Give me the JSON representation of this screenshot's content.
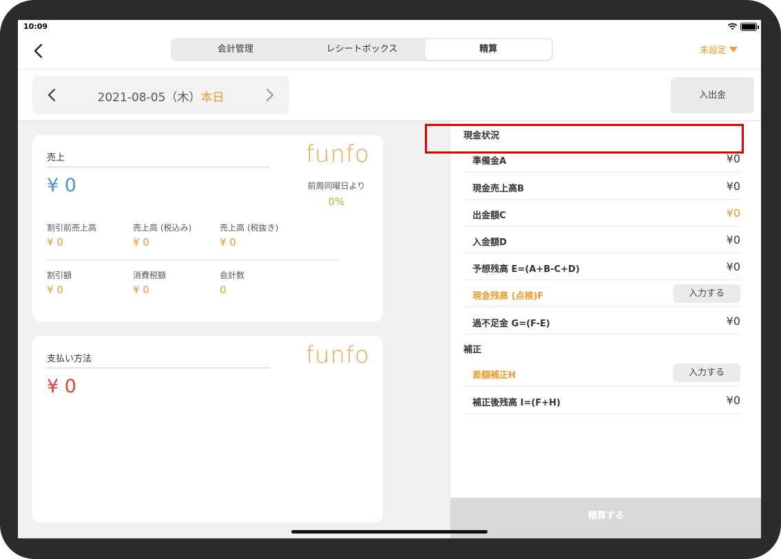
{
  "status": {
    "time": "10:09"
  },
  "nav": {
    "tabs": [
      {
        "label": "会計管理",
        "active": false
      },
      {
        "label": "レシートボックス",
        "active": false
      },
      {
        "label": "精算",
        "active": true
      }
    ],
    "status_label": "未設定"
  },
  "datebar": {
    "date": "2021-08-05（木）",
    "today": "本日",
    "inout_label": "入出金"
  },
  "sales_card": {
    "title": "売上",
    "total": "¥ 0",
    "logo": "funfo",
    "compare_label": "前周同曜日より",
    "compare_value": "0%",
    "metrics": [
      {
        "label": "割引前売上高",
        "value": "¥ 0"
      },
      {
        "label": "売上高 (税込み)",
        "value": "¥ 0"
      },
      {
        "label": "売上高 (税抜き)",
        "value": "¥ 0"
      },
      {
        "label": "割引額",
        "value": "¥ 0"
      },
      {
        "label": "消費税額",
        "value": "¥ 0"
      },
      {
        "label": "会計数",
        "value": "0"
      }
    ]
  },
  "payment_card": {
    "title": "支払い方法",
    "total": "¥ 0",
    "logo": "funfo"
  },
  "cash_status": {
    "title": "現金状況",
    "rows": [
      {
        "label": "準備金A",
        "value": "¥0"
      },
      {
        "label": "現金売上高B",
        "value": "¥0"
      },
      {
        "label": "出金額C",
        "value": "¥0"
      },
      {
        "label": "入金額D",
        "value": "¥0"
      },
      {
        "label": "予想残高 E=(A+B-C+D)",
        "value": "¥0"
      },
      {
        "label": "現金残高 (点検)F",
        "button": "入力する"
      },
      {
        "label": "過不足金 G=(F-E)",
        "value": "¥0"
      }
    ]
  },
  "correction": {
    "title": "補正",
    "rows": [
      {
        "label": "差額補正H",
        "button": "入力する"
      },
      {
        "label": "補正後残高 I=(F+H)",
        "value": "¥0"
      }
    ]
  },
  "settle_label": "精算する",
  "colors": {
    "accent": "#f09a2a",
    "blue": "#4e8fd6",
    "red": "#e0402c",
    "green": "#8dc63f"
  }
}
